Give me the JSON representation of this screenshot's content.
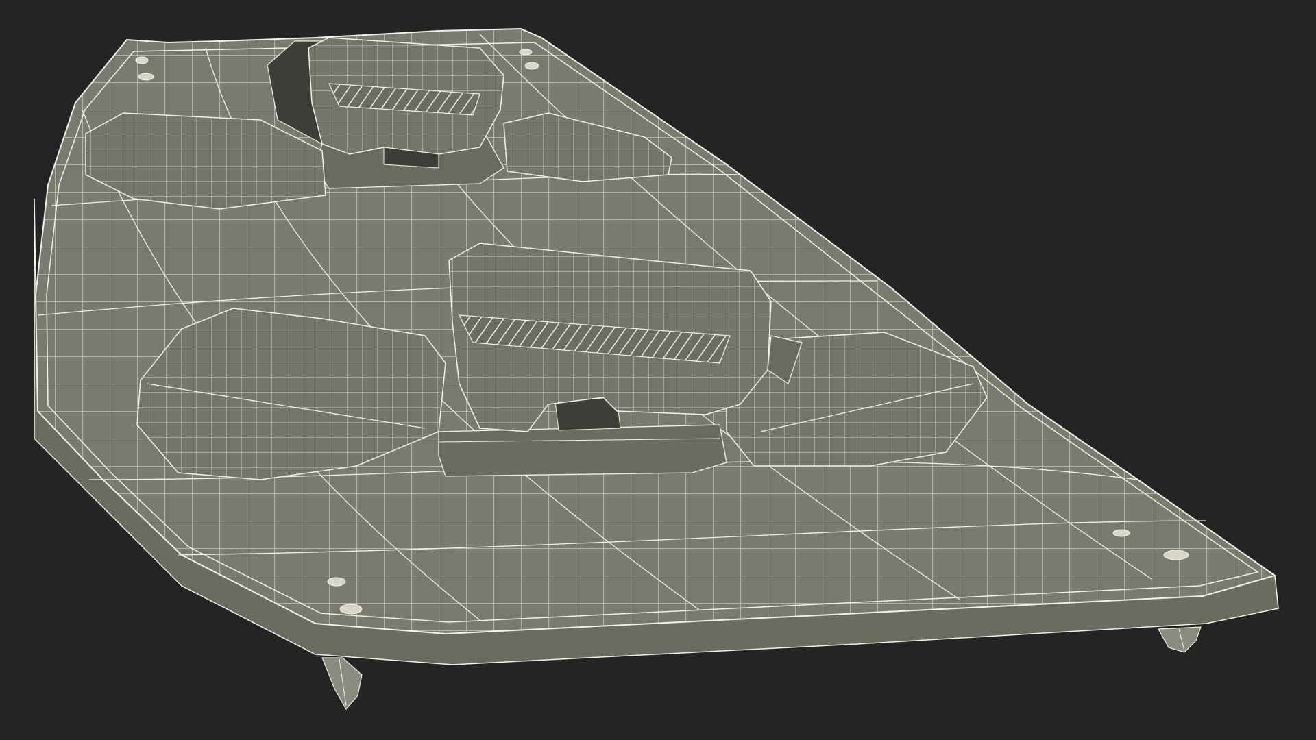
{
  "scene": {
    "subject": "wakeboard-wireframe-render",
    "colors": {
      "background": "#242424",
      "board_fill": "#7a7a6e",
      "board_edge_fill": "#6b6b60",
      "shadow_fill": "#5a5a50",
      "binding_fill": "#75756a",
      "binding_dark": "#3e3e38",
      "wire": "#f2f2ea",
      "hardware": "#d8d6c6",
      "fin": "#8a8a7e"
    },
    "parts": {
      "board": "board-deck",
      "rail": "board-rail",
      "rear_binding": "binding-rear",
      "front_binding": "binding-front",
      "fins": "fin",
      "inserts": "insert-hardware"
    }
  }
}
